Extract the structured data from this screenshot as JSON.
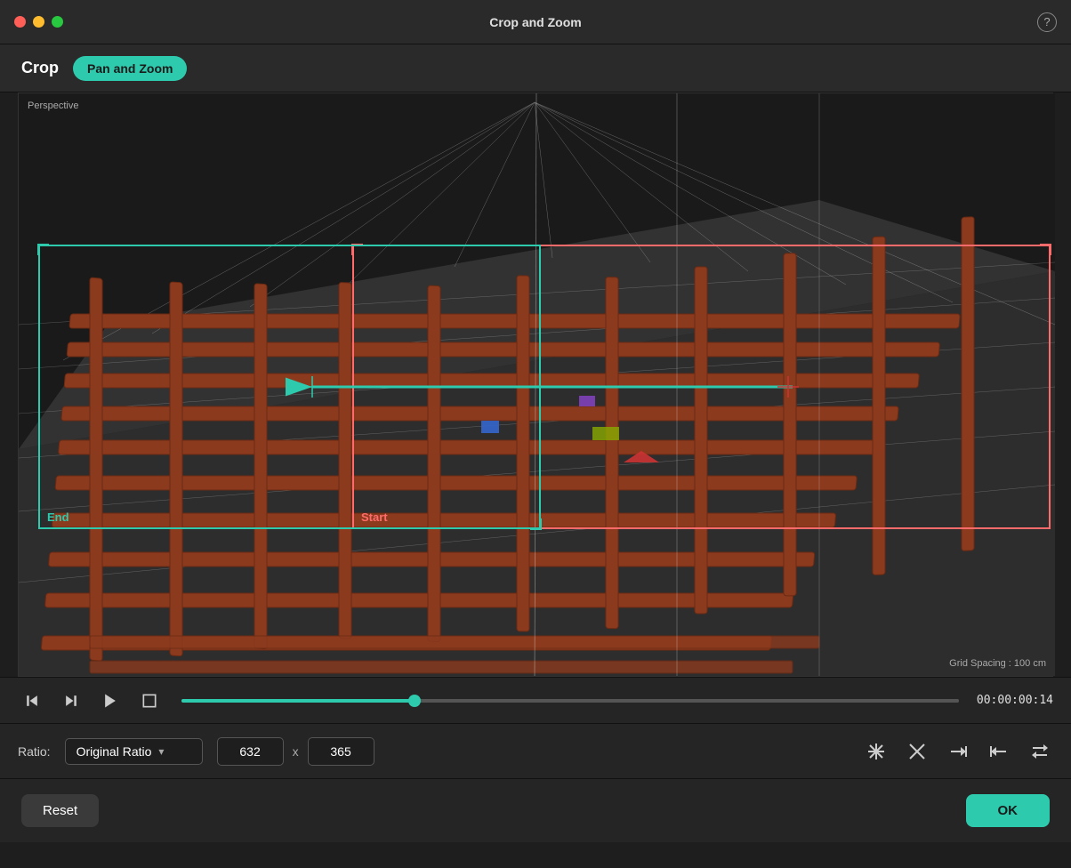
{
  "titleBar": {
    "title": "Crop and Zoom",
    "helpLabel": "?"
  },
  "tabs": {
    "cropLabel": "Crop",
    "panZoomLabel": "Pan and Zoom"
  },
  "viewport": {
    "perspectiveLabel": "Perspective",
    "gridSpacingLabel": "Grid Spacing : 100 cm",
    "startLabel": "Start",
    "endLabel": "End"
  },
  "transport": {
    "timecode": "00:00:00:14"
  },
  "ratio": {
    "label": "Ratio:",
    "selected": "Original Ratio",
    "width": "632",
    "height": "365"
  },
  "actions": {
    "resetLabel": "Reset",
    "okLabel": "OK"
  },
  "icons": {
    "stepBack": "step-back-icon",
    "stepForward": "step-forward-icon",
    "play": "play-icon",
    "stop": "stop-icon",
    "cropFull": "crop-full-icon",
    "cropClear": "crop-clear-icon",
    "cropArrowRight": "crop-arrow-right-icon",
    "cropArrowLeft": "crop-arrow-left-icon",
    "cropSwap": "crop-swap-icon"
  }
}
